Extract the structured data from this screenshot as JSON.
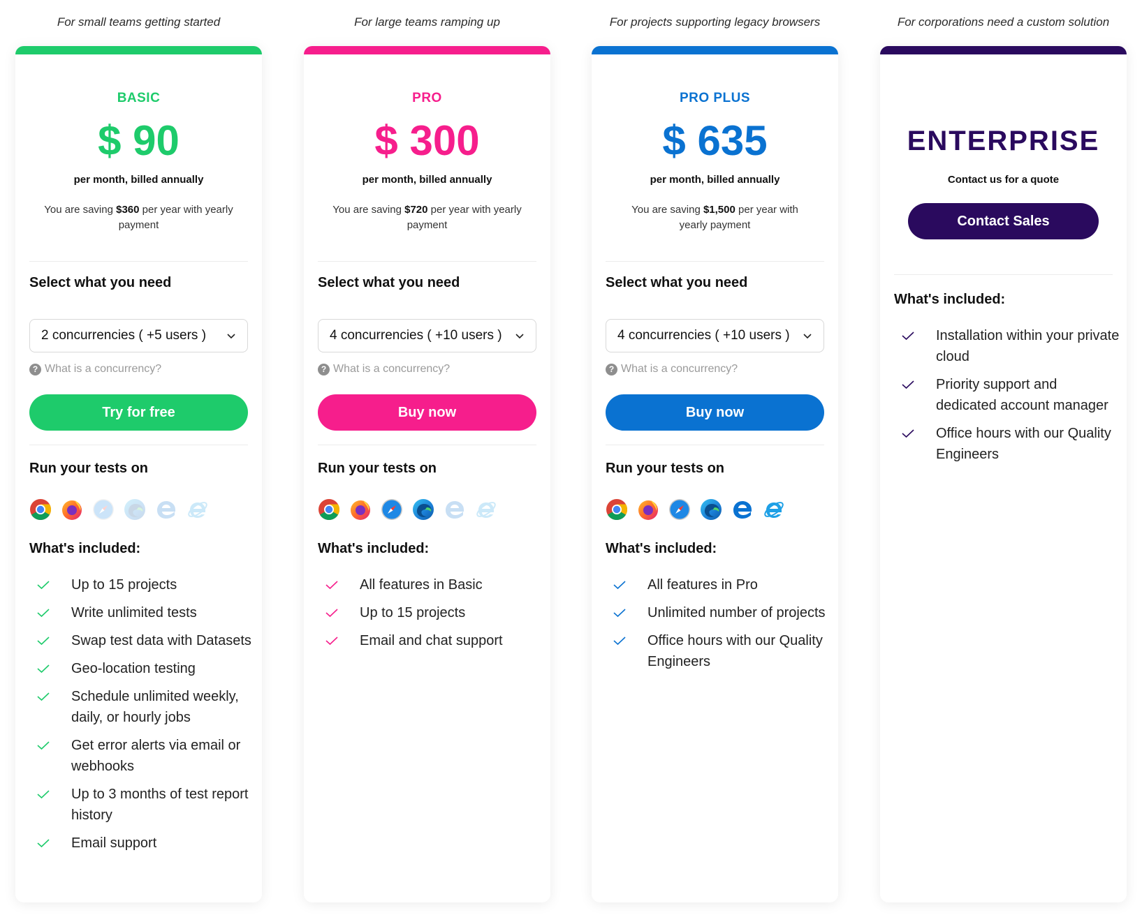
{
  "plans": [
    {
      "tagline": "For small teams getting started",
      "name": "BASIC",
      "price": "$ 90",
      "billing": "per month, billed annually",
      "saving_prefix": "You are saving ",
      "saving_amount": "$360",
      "saving_suffix": " per year with yearly payment",
      "color": "#1ecb6b",
      "select_title": "Select what you need",
      "select_value": "2 concurrencies ( +5 users )",
      "help_text": "What is a concurrency?",
      "cta_label": "Try for free",
      "browsers_title": "Run your tests on",
      "browsers": [
        {
          "name": "chrome",
          "enabled": true
        },
        {
          "name": "firefox",
          "enabled": true
        },
        {
          "name": "safari",
          "enabled": false
        },
        {
          "name": "edge",
          "enabled": false
        },
        {
          "name": "edge-legacy",
          "enabled": false
        },
        {
          "name": "internet-explorer",
          "enabled": false
        }
      ],
      "features_title": "What's included:",
      "features": [
        "Up to 15 projects",
        "Write unlimited tests",
        "Swap test data with Datasets",
        "Geo-location testing",
        "Schedule unlimited weekly, daily, or hourly jobs",
        "Get error alerts via email or webhooks",
        "Up to 3 months of test report history",
        "Email support"
      ]
    },
    {
      "tagline": "For large teams ramping up",
      "name": "PRO",
      "price": "$ 300",
      "billing": "per month, billed annually",
      "saving_prefix": "You are saving ",
      "saving_amount": "$720",
      "saving_suffix": " per year with yearly payment",
      "color": "#f61e8c",
      "select_title": "Select what you need",
      "select_value": "4 concurrencies ( +10 users )",
      "help_text": "What is a concurrency?",
      "cta_label": "Buy now",
      "browsers_title": "Run your tests on",
      "browsers": [
        {
          "name": "chrome",
          "enabled": true
        },
        {
          "name": "firefox",
          "enabled": true
        },
        {
          "name": "safari",
          "enabled": true
        },
        {
          "name": "edge",
          "enabled": true
        },
        {
          "name": "edge-legacy",
          "enabled": false
        },
        {
          "name": "internet-explorer",
          "enabled": false
        }
      ],
      "features_title": "What's included:",
      "features": [
        "All features in Basic",
        "Up to 15 projects",
        "Email and chat support"
      ]
    },
    {
      "tagline": "For projects supporting legacy browsers",
      "name": "PRO PLUS",
      "price": "$ 635",
      "billing": "per month, billed annually",
      "saving_prefix": "You are saving ",
      "saving_amount": "$1,500",
      "saving_suffix": " per year with yearly payment",
      "color": "#0a72d1",
      "select_title": "Select what you need",
      "select_value": "4 concurrencies ( +10 users )",
      "help_text": "What is a concurrency?",
      "cta_label": "Buy now",
      "browsers_title": "Run your tests on",
      "browsers": [
        {
          "name": "chrome",
          "enabled": true
        },
        {
          "name": "firefox",
          "enabled": true
        },
        {
          "name": "safari",
          "enabled": true
        },
        {
          "name": "edge",
          "enabled": true
        },
        {
          "name": "edge-legacy",
          "enabled": true
        },
        {
          "name": "internet-explorer",
          "enabled": true
        }
      ],
      "features_title": "What's included:",
      "features": [
        "All features in Pro",
        "Unlimited number of projects",
        "Office hours with our Quality Engineers"
      ]
    }
  ],
  "enterprise": {
    "tagline": "For corporations need a custom solution",
    "name": "ENTERPRISE",
    "contact_line": "Contact us for a quote",
    "cta_label": "Contact Sales",
    "color": "#2a0a5e",
    "features_title": "What's included:",
    "features": [
      "Installation within your private cloud",
      "Priority support and dedicated account manager",
      "Office hours with our Quality Engineers"
    ]
  }
}
